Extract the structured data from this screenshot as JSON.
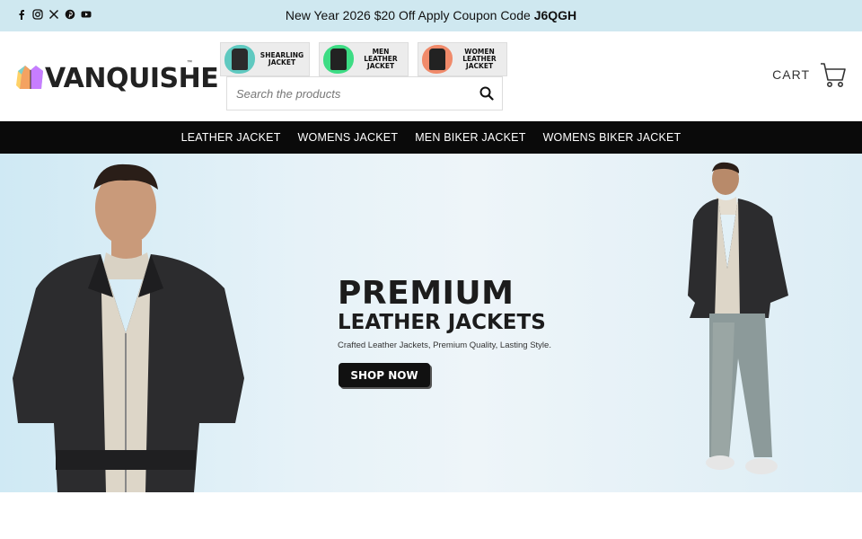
{
  "topbar": {
    "social_icons": [
      "facebook-icon",
      "instagram-icon",
      "x-icon",
      "pinterest-icon",
      "youtube-icon"
    ],
    "promo_text": "New Year 2026 $20 Off Apply Coupon Code ",
    "promo_code": "J6QGH",
    "background": "#cfe8f0"
  },
  "header": {
    "logo_text": "VANQUISHE",
    "logo_tm": "™",
    "categories": [
      {
        "label": "SHEARLING JACKET",
        "color": "#5fc9c0"
      },
      {
        "label": "MEN LEATHER JACKET",
        "color": "#3ddc84"
      },
      {
        "label": "WOMEN LEATHER JACKET",
        "color": "#f08a6a"
      }
    ],
    "search_placeholder": "Search the products",
    "cart_label": "CART"
  },
  "nav": {
    "items": [
      "LEATHER JACKET",
      "WOMENS JACKET",
      "MEN BIKER JACKET",
      "WOMENS BIKER JACKET"
    ]
  },
  "hero": {
    "title": "PREMIUM",
    "subtitle": "LEATHER JACKETS",
    "tagline": "Crafted Leather Jackets, Premium Quality, Lasting Style.",
    "cta": "SHOP NOW"
  }
}
